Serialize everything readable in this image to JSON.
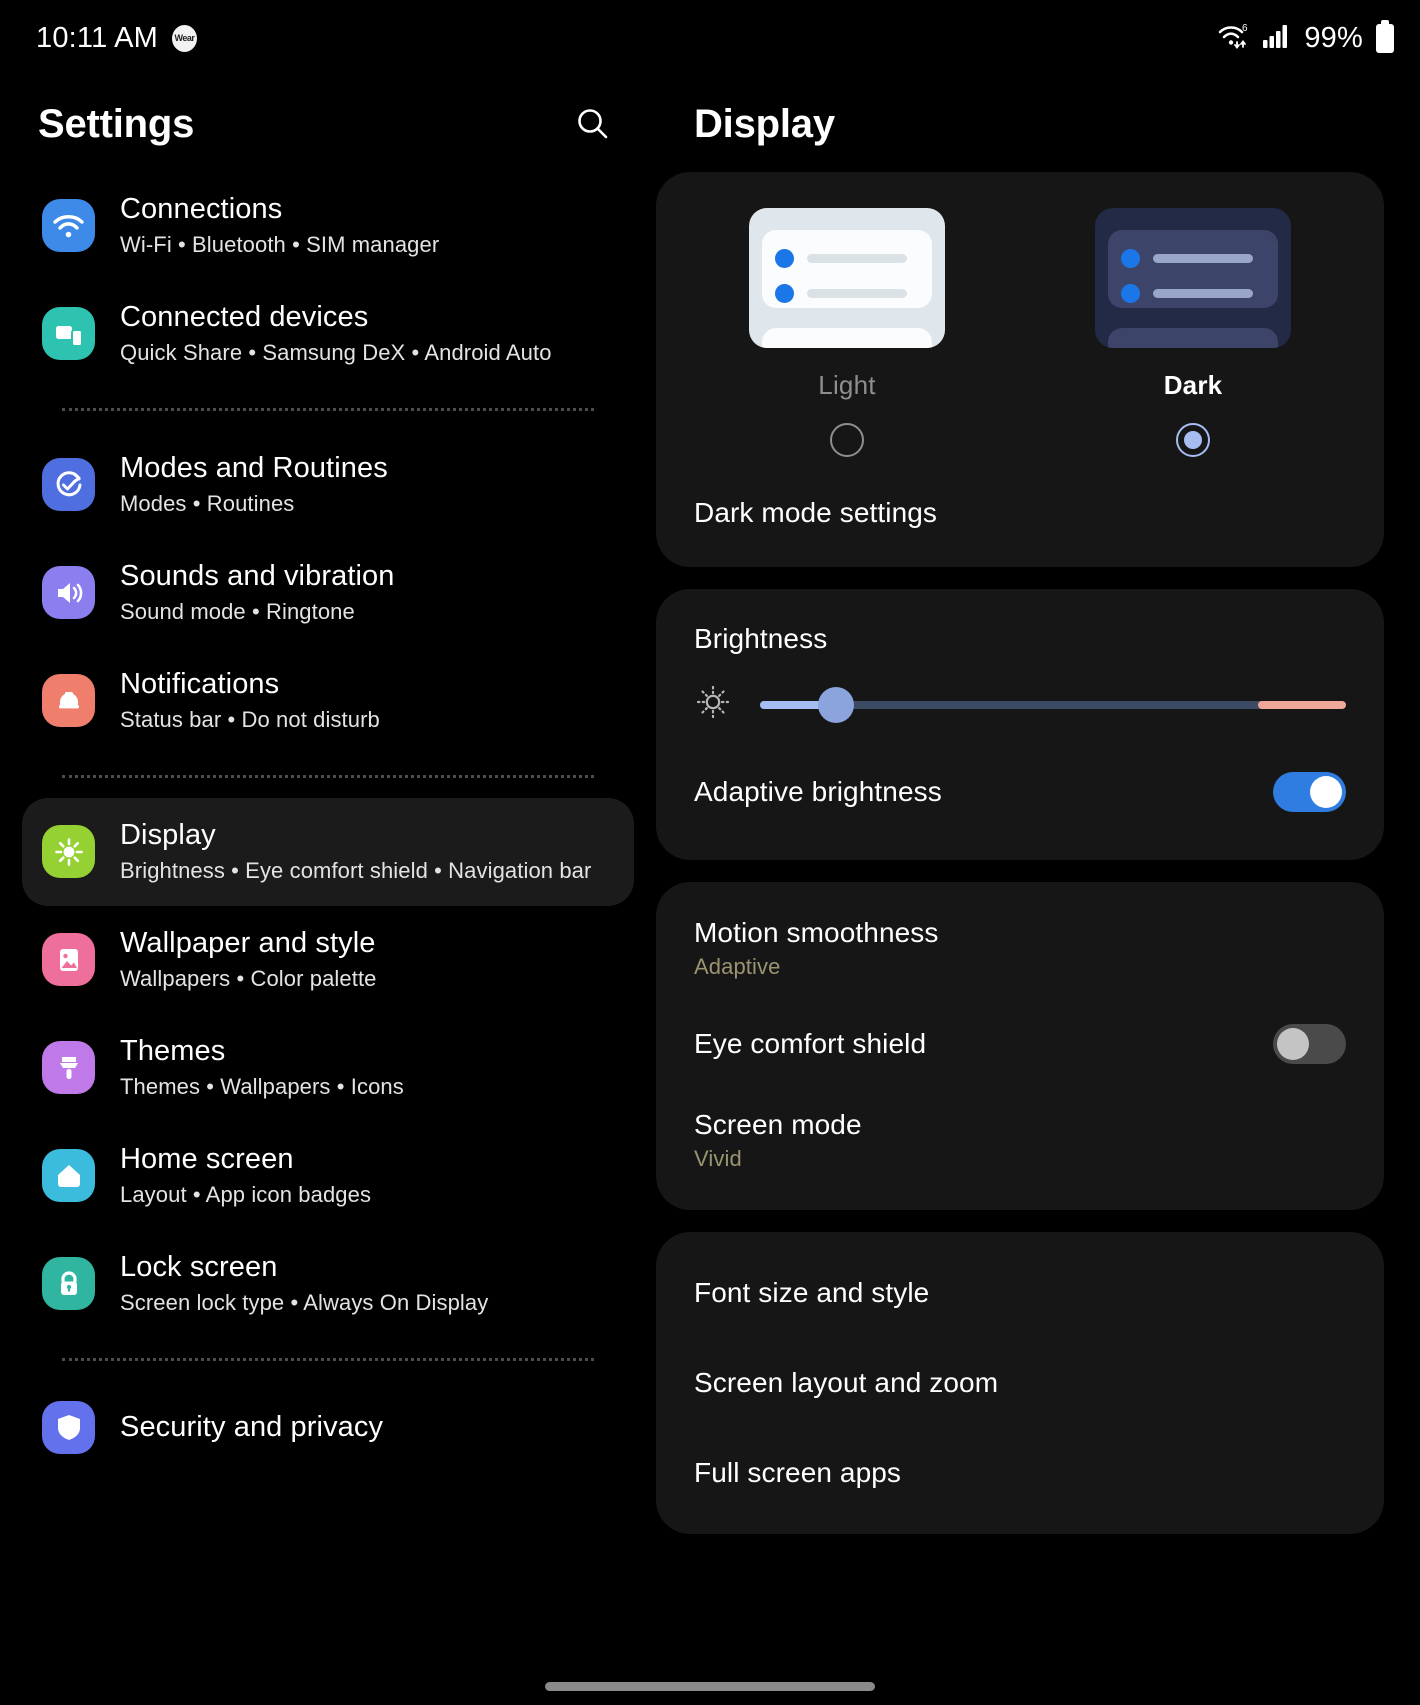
{
  "statusbar": {
    "time": "10:11 AM",
    "badge_label": "Wear",
    "wifi_icon": "wifi-6-icon",
    "signal_icon": "cellular-signal-icon",
    "battery_percent": "99%",
    "battery_icon": "battery-full-icon"
  },
  "sidebar": {
    "title": "Settings",
    "search_icon": "search-icon",
    "groups": [
      {
        "items": [
          {
            "label": "Connections",
            "summary": "Wi-Fi  •  Bluetooth  •  SIM manager",
            "icon": "wifi-icon",
            "icon_color": "#3d8ae8",
            "selected": false
          },
          {
            "label": "Connected devices",
            "summary": "Quick Share  •  Samsung DeX  •  Android Auto",
            "icon": "connected-devices-icon",
            "icon_color": "#2ec2b0",
            "selected": false
          }
        ]
      },
      {
        "items": [
          {
            "label": "Modes and Routines",
            "summary": "Modes  •  Routines",
            "icon": "routines-check-icon",
            "icon_color": "#4f6fe0",
            "selected": false
          },
          {
            "label": "Sounds and vibration",
            "summary": "Sound mode  •  Ringtone",
            "icon": "volume-icon",
            "icon_color": "#8b7ff0",
            "selected": false
          },
          {
            "label": "Notifications",
            "summary": "Status bar  •  Do not disturb",
            "icon": "notification-bell-icon",
            "icon_color": "#ef7f6c",
            "selected": false
          }
        ]
      },
      {
        "items": [
          {
            "label": "Display",
            "summary": "Brightness  •  Eye comfort shield  •  Navigation bar",
            "icon": "brightness-sun-icon",
            "icon_color": "#95d132",
            "selected": true
          },
          {
            "label": "Wallpaper and style",
            "summary": "Wallpapers  •  Color palette",
            "icon": "image-picture-icon",
            "icon_color": "#ef6f9c",
            "selected": false
          },
          {
            "label": "Themes",
            "summary": "Themes  •  Wallpapers  •  Icons",
            "icon": "paint-brush-icon",
            "icon_color": "#bf79e8",
            "selected": false
          },
          {
            "label": "Home screen",
            "summary": "Layout  •  App icon badges",
            "icon": "home-icon",
            "icon_color": "#3cbcdd",
            "selected": false
          },
          {
            "label": "Lock screen",
            "summary": "Screen lock type  •  Always On Display",
            "icon": "lock-icon",
            "icon_color": "#2fb5a0",
            "selected": false
          }
        ]
      },
      {
        "items": [
          {
            "label": "Security and privacy",
            "summary": "",
            "icon": "shield-icon",
            "icon_color": "#6471ec",
            "selected": false
          }
        ]
      }
    ]
  },
  "detail": {
    "title": "Display",
    "theme": {
      "options": [
        {
          "label": "Light",
          "selected": false,
          "preview": "light-mode-preview"
        },
        {
          "label": "Dark",
          "selected": true,
          "preview": "dark-mode-preview"
        }
      ],
      "settings_link": "Dark mode settings"
    },
    "brightness": {
      "title": "Brightness",
      "slider_icon": "brightness-low-icon",
      "value_percent": 13,
      "warm_end_percent": 15,
      "adaptive": {
        "label": "Adaptive brightness",
        "enabled": true
      }
    },
    "display_options": [
      {
        "label": "Motion smoothness",
        "value": "Adaptive",
        "control": "none"
      },
      {
        "label": "Eye comfort shield",
        "value": "",
        "control": "toggle",
        "enabled": false
      },
      {
        "label": "Screen mode",
        "value": "Vivid",
        "control": "none"
      }
    ],
    "links": [
      {
        "label": "Font size and style"
      },
      {
        "label": "Screen layout and zoom"
      },
      {
        "label": "Full screen apps"
      }
    ]
  },
  "colors": {
    "accent_blue": "#2f7de1",
    "radio_selected": "#a5bdf0",
    "slider_fill": "#a5bdf0",
    "slider_warm": "#f0a89a",
    "card_bg": "#161616",
    "subtitle_olive": "#9a9470"
  }
}
